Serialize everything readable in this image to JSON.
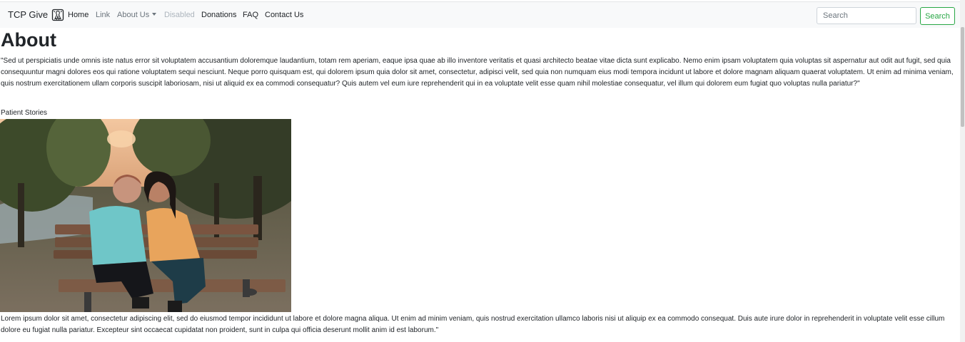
{
  "navbar": {
    "brand": "TCP Give",
    "logo_icon": "ribbon-logo-icon",
    "links": [
      {
        "label": "Home"
      },
      {
        "label": "Link"
      },
      {
        "label": "About Us"
      },
      {
        "label": "Disabled"
      },
      {
        "label": "Donations"
      },
      {
        "label": "FAQ"
      },
      {
        "label": "Contact Us"
      }
    ],
    "search": {
      "placeholder": "Search",
      "button_label": "Search"
    }
  },
  "main": {
    "title": "About",
    "intro": "\"Sed ut perspiciatis unde omnis iste natus error sit voluptatem accusantium doloremque laudantium, totam rem aperiam, eaque ipsa quae ab illo inventore veritatis et quasi architecto beatae vitae dicta sunt explicabo. Nemo enim ipsam voluptatem quia voluptas sit aspernatur aut odit aut fugit, sed quia consequuntur magni dolores eos qui ratione voluptatem sequi nesciunt. Neque porro quisquam est, qui dolorem ipsum quia dolor sit amet, consectetur, adipisci velit, sed quia non numquam eius modi tempora incidunt ut labore et dolore magnam aliquam quaerat voluptatem. Ut enim ad minima veniam, quis nostrum exercitationem ullam corporis suscipit laboriosam, nisi ut aliquid ex ea commodi consequatur? Quis autem vel eum iure reprehenderit qui in ea voluptate velit esse quam nihil molestiae consequatur, vel illum qui dolorem eum fugiat quo voluptas nulla pariatur?\"",
    "subheading": "Patient Stories",
    "story_text": "Lorem ipsum dolor sit amet, consectetur adipiscing elit, sed do eiusmod tempor incididunt ut labore et dolore magna aliqua. Ut enim ad minim veniam, quis nostrud exercitation ullamco laboris nisi ut aliquip ex ea commodo consequat. Duis aute irure dolor in reprehenderit in voluptate velit esse cillum dolore eu fugiat nulla pariatur. Excepteur sint occaecat cupidatat non proident, sunt in culpa qui officia deserunt mollit anim id est laborum.\""
  },
  "colors": {
    "navbar_bg": "#f8f9fa",
    "text": "#212529",
    "muted_link": "#6c757d",
    "disabled_link": "#adb5bd",
    "search_accent": "#28a745"
  }
}
